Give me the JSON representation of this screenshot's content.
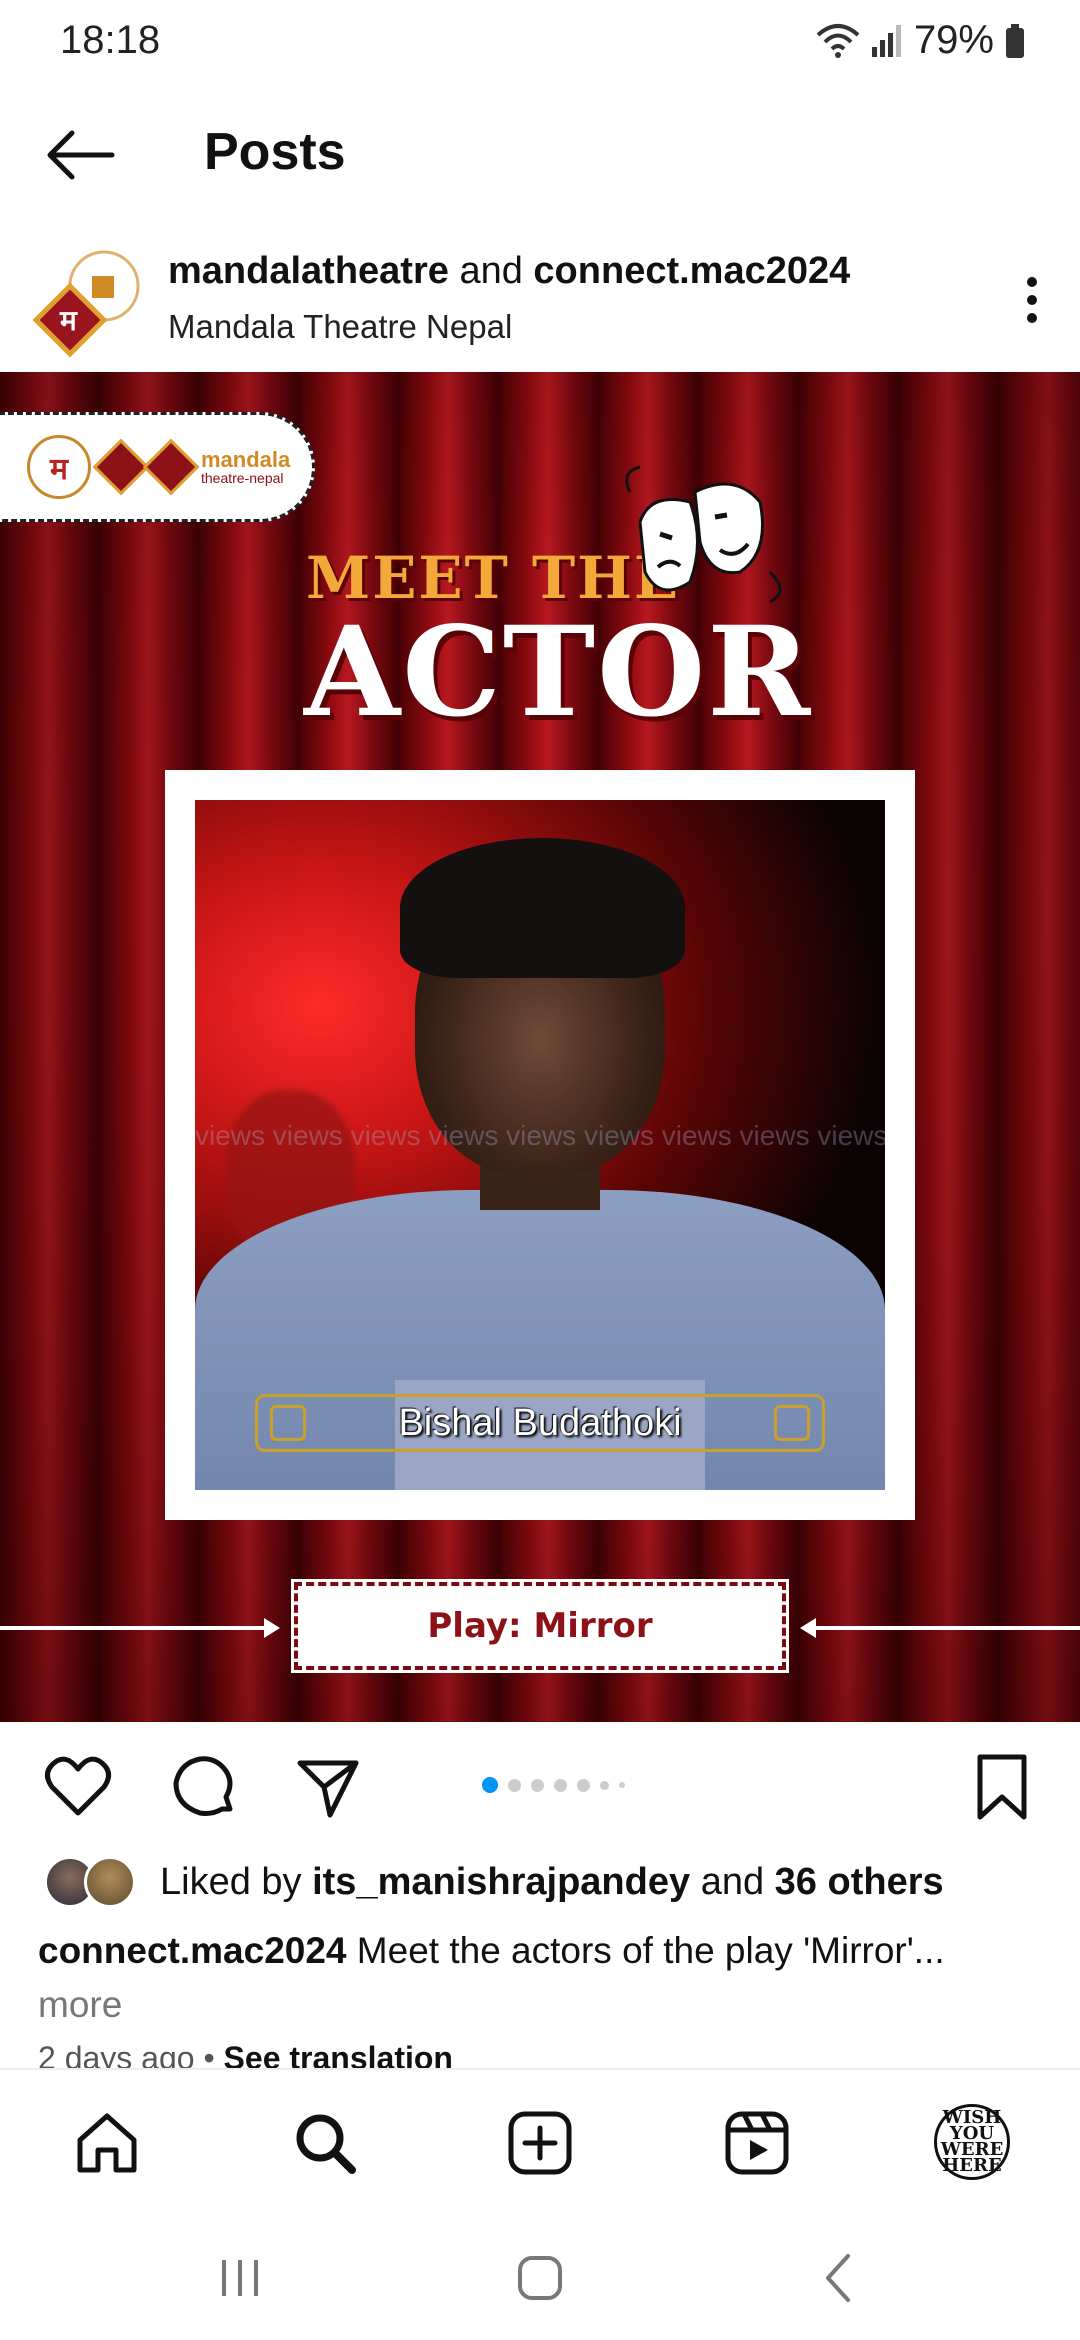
{
  "status_bar": {
    "time": "18:18",
    "battery": "79%"
  },
  "header": {
    "title": "Posts"
  },
  "post": {
    "author_primary": "mandalatheatre",
    "author_connector": " and ",
    "author_secondary": "connect.mac2024",
    "subtitle": "Mandala Theatre Nepal",
    "image": {
      "logo_text_top": "mandala",
      "logo_text_bottom": "theatre-nepal",
      "meet_the": "MEET THE",
      "actor": "ACTOR",
      "actor_name": "Bishal Budathoki",
      "watermark": "views views views views views views views views views views",
      "play_label": "Play: Mirror"
    },
    "carousel": {
      "total": 7,
      "active_index": 0
    },
    "likes": {
      "prefix": "Liked by ",
      "user": "its_manishrajpandey",
      "connector": " and ",
      "count_text": "36 others"
    },
    "caption": {
      "user": "connect.mac2024",
      "text": " Meet the actors of the play 'Mirror'...",
      "more": "more"
    },
    "meta": {
      "age": "2 days ago",
      "separator": " • ",
      "translate": "See translation"
    }
  },
  "bottom_nav": {
    "profile_text": "WISH YOU WERE HERE"
  },
  "icons": {
    "back": "back-arrow-icon",
    "more": "more-vertical-icon",
    "like": "heart-icon",
    "comment": "comment-icon",
    "share": "send-icon",
    "save": "bookmark-icon",
    "home": "home-icon",
    "search": "search-icon",
    "create": "create-icon",
    "reels": "reels-icon"
  },
  "colors": {
    "accent": "#0095f6",
    "curtain": "#8c0a10",
    "title_orange": "#f2a93a"
  }
}
